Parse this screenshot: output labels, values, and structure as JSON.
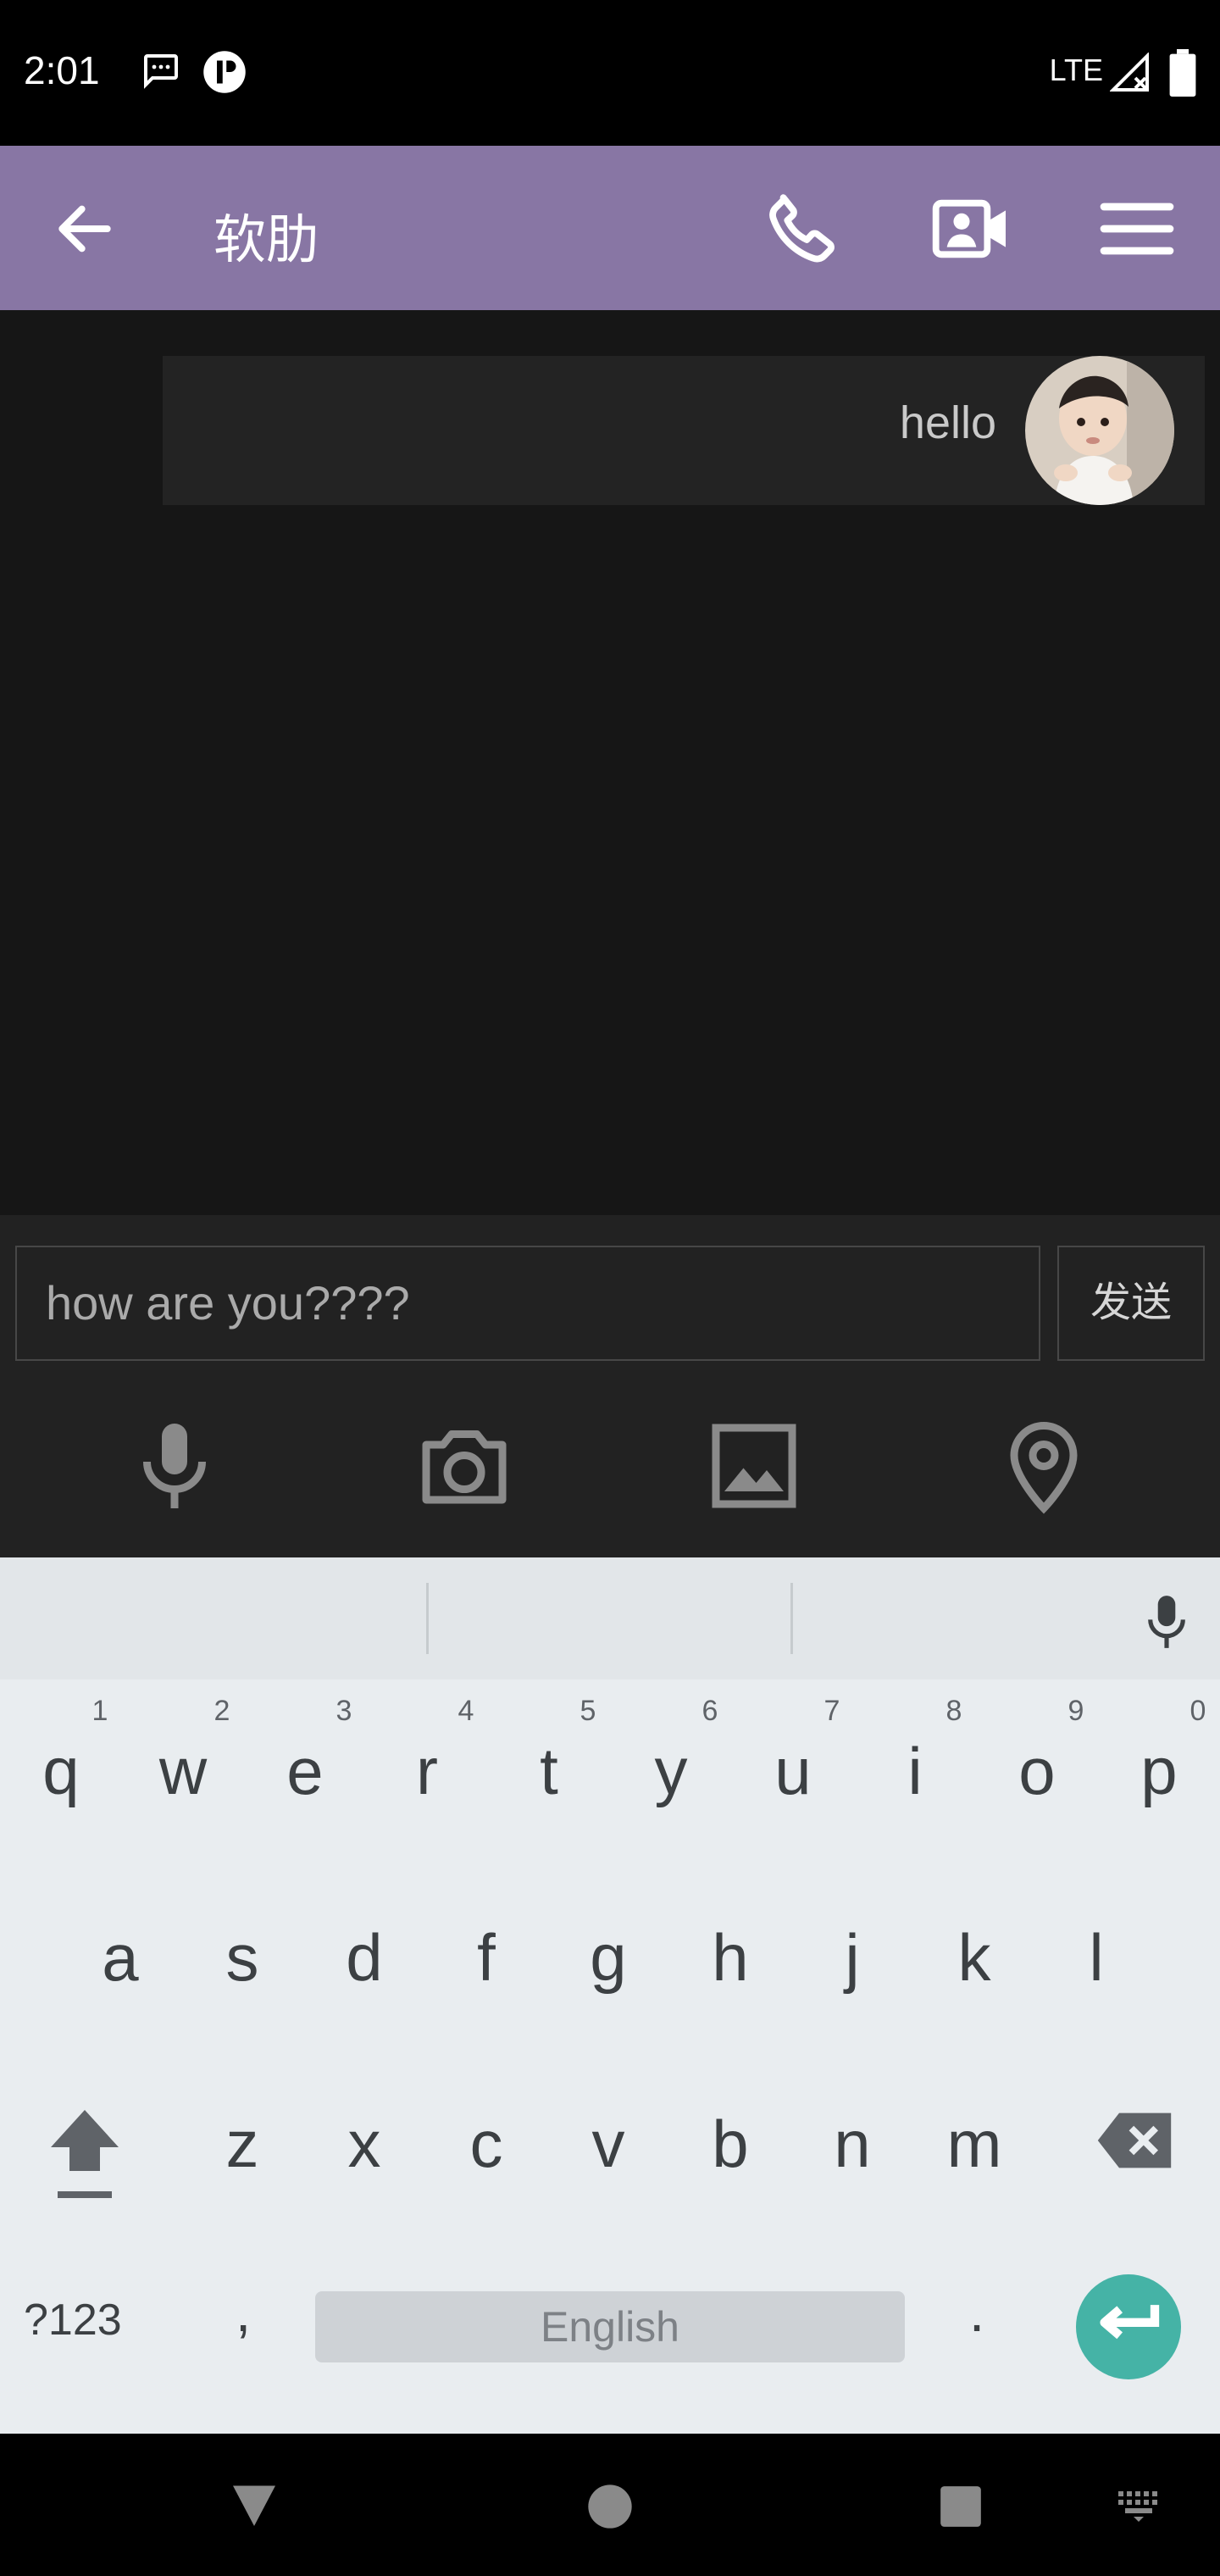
{
  "status_bar": {
    "time": "2:01",
    "network": "LTE"
  },
  "app_bar": {
    "title": "软肋"
  },
  "chat": {
    "messages": [
      {
        "text": "hello",
        "sender": "me"
      }
    ]
  },
  "composer": {
    "input_value": "how are you????",
    "send_label": "发送"
  },
  "keyboard": {
    "row1": [
      {
        "key": "q",
        "hint": "1"
      },
      {
        "key": "w",
        "hint": "2"
      },
      {
        "key": "e",
        "hint": "3"
      },
      {
        "key": "r",
        "hint": "4"
      },
      {
        "key": "t",
        "hint": "5"
      },
      {
        "key": "y",
        "hint": "6"
      },
      {
        "key": "u",
        "hint": "7"
      },
      {
        "key": "i",
        "hint": "8"
      },
      {
        "key": "o",
        "hint": "9"
      },
      {
        "key": "p",
        "hint": "0"
      }
    ],
    "row2": [
      "a",
      "s",
      "d",
      "f",
      "g",
      "h",
      "j",
      "k",
      "l"
    ],
    "row3": [
      "z",
      "x",
      "c",
      "v",
      "b",
      "n",
      "m"
    ],
    "symbols_label": "?123",
    "comma": ",",
    "period": ".",
    "space_label": "English"
  },
  "colors": {
    "app_bar": "#8876a4",
    "chat_bg": "#161616",
    "enter_key": "#45b3a6"
  }
}
